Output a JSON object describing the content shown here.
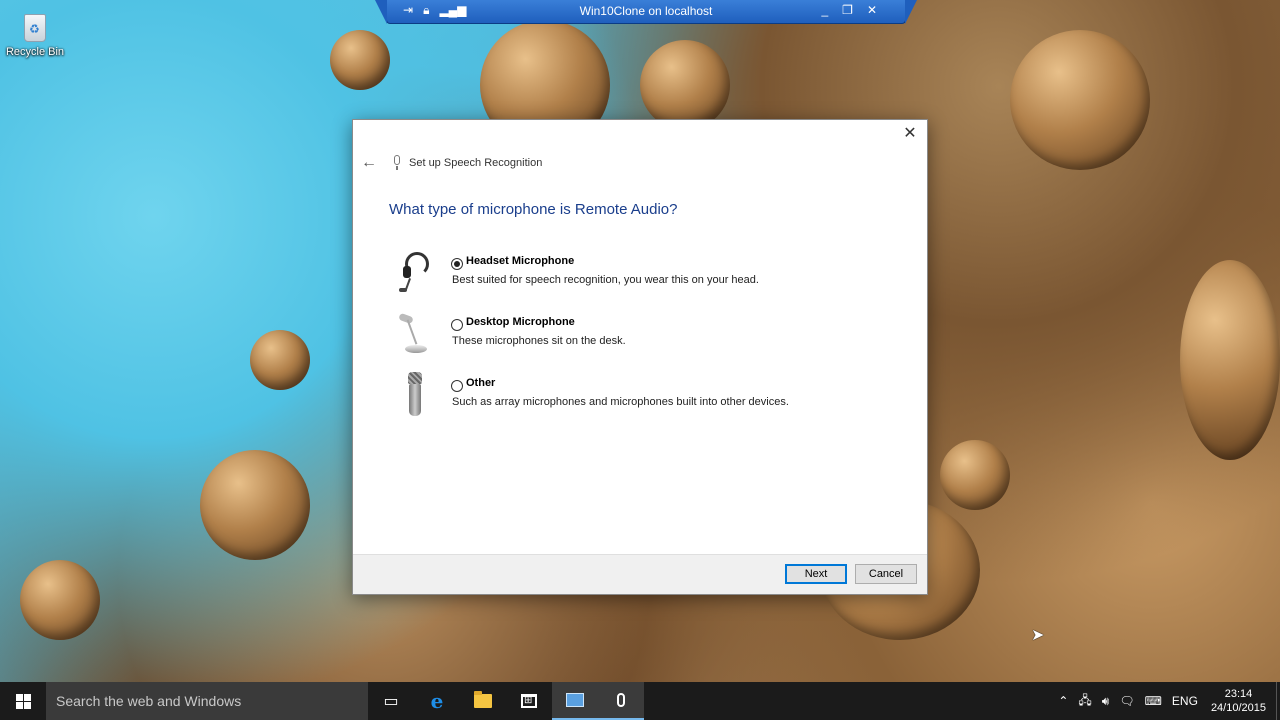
{
  "desktop": {
    "recycle_bin_label": "Recycle Bin"
  },
  "remote_bar": {
    "title": "Win10Clone on localhost",
    "left_icons": [
      "pin-icon",
      "lock-icon",
      "signal-icon"
    ],
    "right_icons": [
      "minimize-icon",
      "restore-icon",
      "close-icon"
    ]
  },
  "dialog": {
    "title": "Set up Speech Recognition",
    "question": "What type of microphone is Remote Audio?",
    "options": [
      {
        "label": "Headset Microphone",
        "description": "Best suited for speech recognition, you wear this on your head.",
        "checked": true,
        "icon": "headset-microphone-icon"
      },
      {
        "label": "Desktop Microphone",
        "description": "These microphones sit on the desk.",
        "checked": false,
        "icon": "desktop-microphone-icon"
      },
      {
        "label": "Other",
        "description": "Such as array microphones and microphones built into other devices.",
        "checked": false,
        "icon": "handheld-microphone-icon"
      }
    ],
    "next_label": "Next",
    "cancel_label": "Cancel"
  },
  "taskbar": {
    "search_placeholder": "Search the web and Windows",
    "language": "ENG",
    "time": "23:14",
    "date": "24/10/2015"
  }
}
